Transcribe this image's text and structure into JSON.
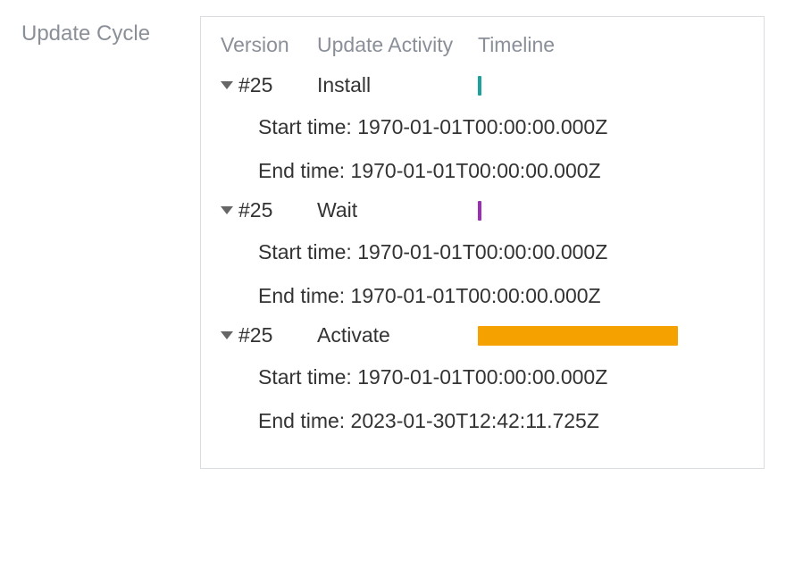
{
  "sideLabel": "Update Cycle",
  "headers": {
    "version": "Version",
    "activity": "Update Activity",
    "timeline": "Timeline"
  },
  "labels": {
    "start": "Start time:",
    "end": "End time:"
  },
  "entries": [
    {
      "version": "#25",
      "activity": "Install",
      "bar": {
        "color": "#1aa39a",
        "widthPx": 4
      },
      "start": "1970-01-01T00:00:00.000Z",
      "end": "1970-01-01T00:00:00.000Z"
    },
    {
      "version": "#25",
      "activity": "Wait",
      "bar": {
        "color": "#9a2fb5",
        "widthPx": 4
      },
      "start": "1970-01-01T00:00:00.000Z",
      "end": "1970-01-01T00:00:00.000Z"
    },
    {
      "version": "#25",
      "activity": "Activate",
      "bar": {
        "color": "#f5a200",
        "widthPx": 224
      },
      "start": "1970-01-01T00:00:00.000Z",
      "end": "2023-01-30T12:42:11.725Z"
    }
  ]
}
